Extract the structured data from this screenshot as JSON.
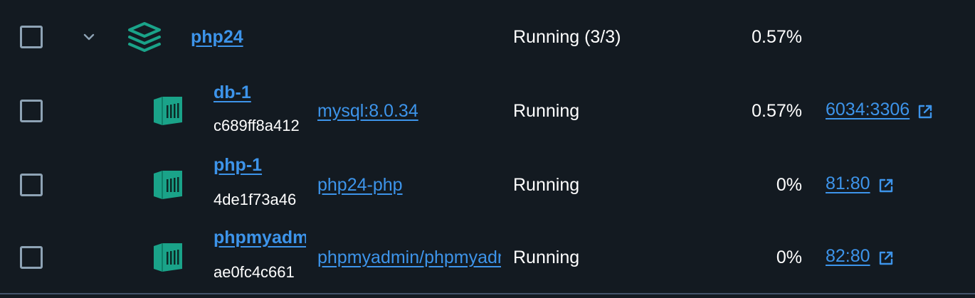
{
  "stack": {
    "name": "php24",
    "status": "Running (3/3)",
    "cpu": "0.57%",
    "icon": "layers-icon",
    "accent": "#1aa389"
  },
  "containers": [
    {
      "name": "db-1",
      "id": "c689ff8a412",
      "image": "mysql:8.0.34",
      "status": "Running",
      "cpu": "0.57%",
      "port": "6034:3306"
    },
    {
      "name": "php-1",
      "id": "4de1f73a46",
      "image": "php24-php",
      "status": "Running",
      "cpu": "0%",
      "port": "81:80"
    },
    {
      "name": "phpmyadmin",
      "id": "ae0fc4c661",
      "image": "phpmyadmin/phpmyadmin",
      "status": "Running",
      "cpu": "0%",
      "port": "82:80"
    }
  ],
  "colors": {
    "background": "#131a21",
    "link": "#3d94ea",
    "icon": "#1aa389",
    "checkbox_border": "#8ea3b5"
  }
}
